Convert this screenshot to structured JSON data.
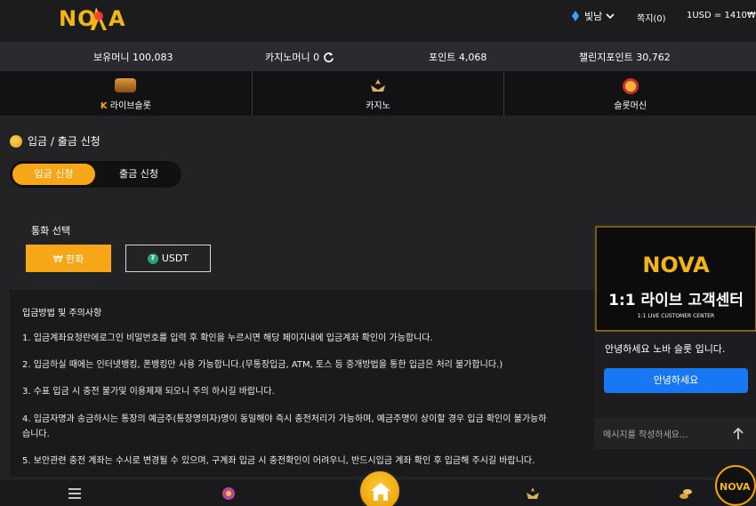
{
  "header": {
    "logo_text": "NOVA",
    "user": "빛남",
    "notes": "쪽지(0)",
    "rate": "1USD = 1410₩"
  },
  "balances": {
    "money": "보유머니 100,083",
    "casino": "카지노머니 0",
    "points": "포인트 4,068",
    "challenge": "챌린지포인트 30,762"
  },
  "categories": [
    {
      "label": "라이브슬롯",
      "icon": "slot-icon"
    },
    {
      "label": "카지노",
      "icon": "casino-icon"
    },
    {
      "label": "슬롯머신",
      "icon": "slot-machine-icon"
    }
  ],
  "page": {
    "title": "입금 / 출금 신청",
    "tab_deposit": "입금 신청",
    "tab_withdraw": "출금 신청"
  },
  "currency": {
    "label": "통화 선택",
    "krw": "₩ 한화",
    "usdt": "USDT"
  },
  "notice": {
    "title": "입금방법 및 주의사항",
    "items": [
      "1. 입금계좌요청란에로그인 비밀번호를 입력 후 확인을 누르시면 해당 페이지내에 입금계좌 확인이 가능합니다.",
      "2. 입금하실 때에는 인터넷뱅킹, 폰뱅킹만 사용 가능합니다.(무통장입금, ATM, 토스 등 중개방법을 통한 입금은 처리 불가합니다.)",
      "3. 수표 입금 시 충전 불가및 이용제재 되오니 주의 하시길 바랍니다.",
      "4. 입금자명과 송금하시는 통장의 예금주(통장명의자)명이 동일해야 즉시 충전처리가 가능하며, 예금주명이 상이할 경우 입금 확인이 불가능하",
      "습니다.",
      "5. 보안관련 충전 계좌는 수시로 변경될 수 있으며, 구계좌 입금 시 충전확인이 어려우니, 반드시입금 계좌 확인 후 입금해 주시길 바랍니다."
    ]
  },
  "chat": {
    "banner_logo": "NOVA",
    "banner_title": "1:1 라이브 고객센터",
    "banner_sub": "1:1 LIVE CUSTOMER CENTER",
    "greeting": "안녕하세요 노바 슬롯 입니다.",
    "reply_button": "안녕하세요",
    "input_placeholder": "메시지를 작성하세요..."
  },
  "bottom_nav": [
    "menu-icon",
    "slot-icon",
    "home-icon",
    "casino-icon",
    "coins-icon"
  ],
  "colors": {
    "accent": "#f7a617",
    "chat_button": "#1877f2"
  }
}
